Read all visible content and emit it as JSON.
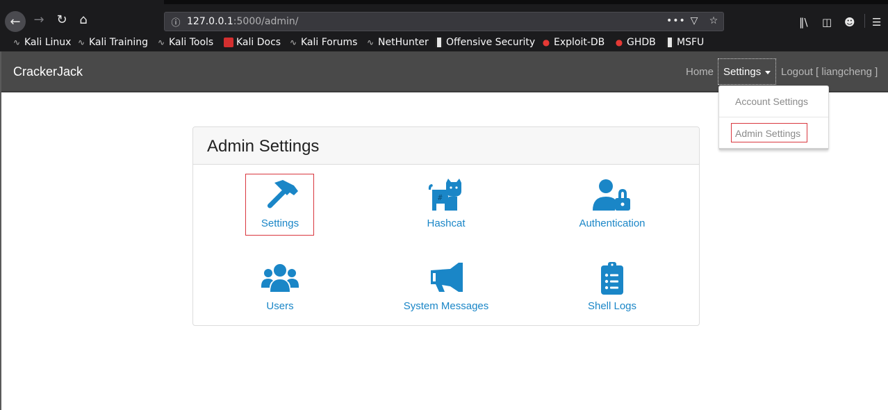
{
  "browser": {
    "url_host": "127.0.0.1",
    "url_path": ":5000/admin/",
    "bookmarks": [
      {
        "label": "Kali Linux",
        "icon": "kali-dragon-icon"
      },
      {
        "label": "Kali Training",
        "icon": "kali-dragon-icon"
      },
      {
        "label": "Kali Tools",
        "icon": "kali-dragon-icon"
      },
      {
        "label": "Kali Docs",
        "icon": "docs-icon"
      },
      {
        "label": "Kali Forums",
        "icon": "kali-dragon-icon"
      },
      {
        "label": "NetHunter",
        "icon": "nethunter-icon"
      },
      {
        "label": "Offensive Security",
        "icon": "offsec-icon"
      },
      {
        "label": "Exploit-DB",
        "icon": "exploitdb-bug-icon"
      },
      {
        "label": "GHDB",
        "icon": "exploitdb-bug-icon"
      },
      {
        "label": "MSFU",
        "icon": "offsec-icon"
      }
    ]
  },
  "navbar": {
    "brand": "CrackerJack",
    "home": "Home",
    "settings": "Settings",
    "logout": "Logout [ liangcheng ]"
  },
  "dropdown": {
    "account_settings": "Account Settings",
    "admin_settings": "Admin Settings"
  },
  "card": {
    "title": "Admin Settings",
    "tiles": [
      {
        "label": "Settings",
        "icon": "hammer-icon"
      },
      {
        "label": "Hashcat",
        "icon": "cat-icon"
      },
      {
        "label": "Authentication",
        "icon": "user-lock-icon"
      },
      {
        "label": "Users",
        "icon": "users-icon"
      },
      {
        "label": "System Messages",
        "icon": "megaphone-icon"
      },
      {
        "label": "Shell Logs",
        "icon": "clipboard-list-icon"
      }
    ]
  },
  "colors": {
    "accent": "#1a86c7",
    "navbar_bg": "#494949",
    "highlight": "#d9363e"
  }
}
